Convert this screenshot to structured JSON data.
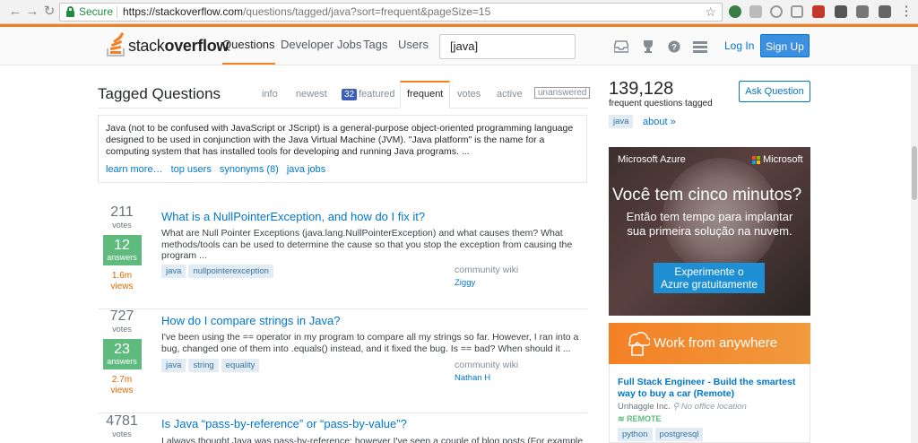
{
  "browser": {
    "secure_label": "Secure",
    "url_host": "https://stackoverflow.com",
    "url_rest": "/questions/tagged/java?sort=frequent&pageSize=15"
  },
  "header": {
    "logo_plain": "stack",
    "logo_bold": "overflow",
    "nav": [
      "Questions",
      "Developer Jobs",
      "Tags",
      "Users"
    ],
    "search_value": "[java]",
    "login": "Log In",
    "signup": "Sign Up"
  },
  "main": {
    "title": "Tagged Questions",
    "tabs": {
      "info": "info",
      "newest": "newest",
      "featured_count": "32",
      "featured": "featured",
      "frequent": "frequent",
      "votes": "votes",
      "active": "active",
      "unanswered": "unanswered"
    },
    "wiki_text": "Java (not to be confused with JavaScript or JScript) is a general-purpose object-oriented programming language designed to be used in conjunction with the Java Virtual Machine (JVM). \"Java platform\" is the name for a computing system that has installed tools for developing and running Java programs. ...",
    "wiki_links": [
      "learn more…",
      "top users",
      "synonyms (8)",
      "java jobs"
    ]
  },
  "questions": [
    {
      "votes": "211",
      "votes_label": "votes",
      "answers": "12",
      "answers_label": "answers",
      "views": "1.6m",
      "views_label": "views",
      "title": "What is a NullPointerException, and how do I fix it?",
      "excerpt": "What are Null Pointer Exceptions (java.lang.NullPointerException) and what causes them? What methods/tools can be used to determine the cause so that you stop the exception from causing the program ...",
      "tags": [
        "java",
        "nullpointerexception"
      ],
      "owner_label": "community wiki",
      "owner": "Ziggy"
    },
    {
      "votes": "727",
      "votes_label": "votes",
      "answers": "23",
      "answers_label": "answers",
      "views": "2.7m",
      "views_label": "views",
      "title": "How do I compare strings in Java?",
      "excerpt": "I've been using the == operator in my program to compare all my strings so far. However, I ran into a bug, changed one of them into .equals() instead, and it fixed the bug. Is == bad? When should it ...",
      "tags": [
        "java",
        "string",
        "equality"
      ],
      "owner_label": "community wiki",
      "owner": "Nathan H"
    },
    {
      "votes": "4781",
      "votes_label": "votes",
      "title": "Is Java “pass-by-reference” or “pass-by-value”?",
      "excerpt": "I always thought Java was pass-by-reference; however I've seen a couple of blog posts (For example, this"
    }
  ],
  "sidebar": {
    "count": "139,128",
    "count_label": "frequent questions tagged",
    "ask_button": "Ask Question",
    "tag": "java",
    "about": "about »",
    "ad": {
      "brand": "Microsoft Azure",
      "ms_name": "Microsoft",
      "headline": "Você tem cinco minutos?",
      "sub1": "Então tem tempo para implantar",
      "sub2": "sua primeira solução na nuvem.",
      "button1": "Experimente o",
      "button2": "Azure gratuitamente"
    },
    "jobs": {
      "banner": "Work from anywhere",
      "title": "Full Stack Engineer - Build the smartest way to buy a car (Remote)",
      "company": "Unhaggle Inc.",
      "location": "No office location",
      "remote": "REMOTE",
      "tags": [
        "python",
        "postgresql"
      ]
    }
  }
}
